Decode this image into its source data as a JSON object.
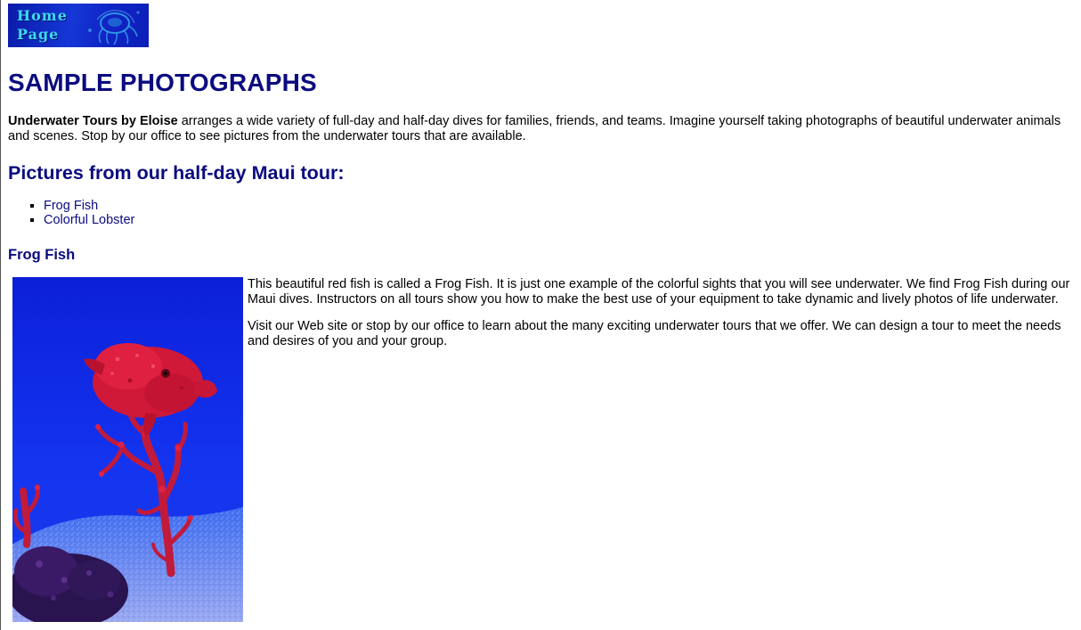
{
  "banner": {
    "line1": "Home",
    "line2": "Page"
  },
  "page_title": "SAMPLE PHOTOGRAPHS",
  "intro": {
    "company": "Underwater Tours by Eloise",
    "text": " arranges a wide variety of full-day and half-day dives for families, friends, and teams. Imagine yourself taking photographs of beautiful underwater animals and scenes. Stop by our office to see pictures from the underwater tours that are available."
  },
  "section": {
    "title": "Pictures from our half-day Maui tour:",
    "links": [
      {
        "label": "Frog Fish"
      },
      {
        "label": "Colorful Lobster"
      }
    ]
  },
  "frog_fish": {
    "heading": "Frog Fish",
    "paragraph1": "This beautiful red fish is called a Frog Fish. It is just one example of the colorful sights that you will see underwater. We find Frog Fish during our Maui dives. Instructors on all tours show you how to make the best use of your equipment to take dynamic and lively photos of life underwater.",
    "paragraph2": "Visit our Web site or stop by our office to learn about the many exciting underwater tours that we offer. We can design a tour to meet the needs and desires of you and your group."
  },
  "colors": {
    "heading": "#0b0b80",
    "link": "#0b0b80",
    "banner_text": "#3fd8f5",
    "photo_water": "#1028e0",
    "fish": "#d01838"
  },
  "icons": {
    "banner_graphic": "jellyfish-icon",
    "list_bullet": "square-bullet"
  }
}
